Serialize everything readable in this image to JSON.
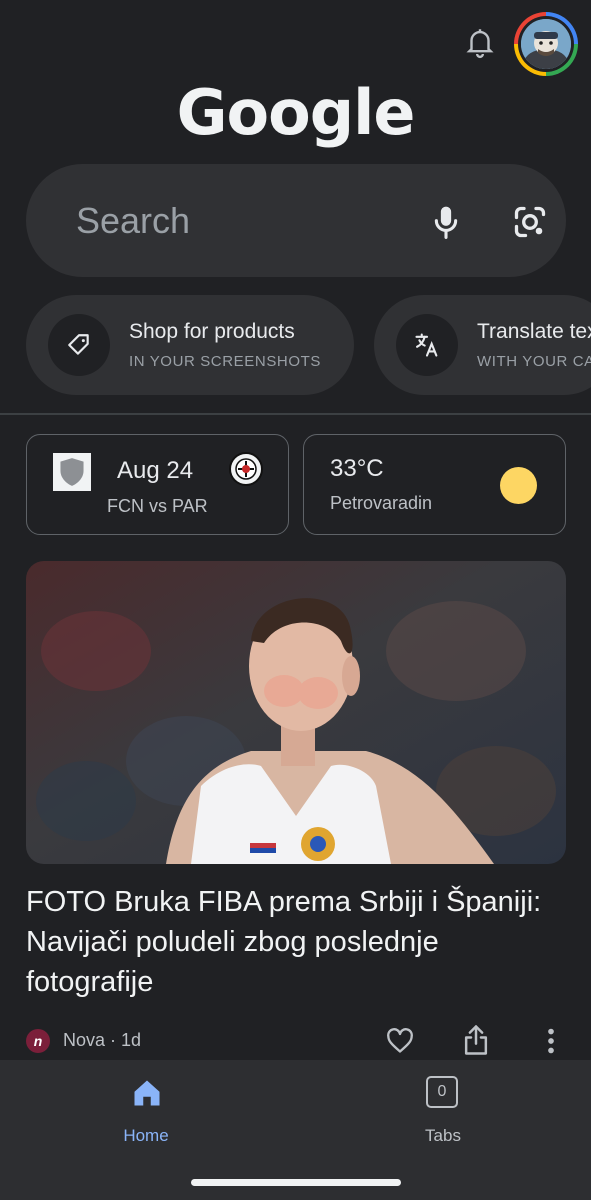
{
  "header": {
    "logo_text": "Google",
    "bell_icon": "bell-icon",
    "avatar_icon": "account-avatar"
  },
  "search": {
    "placeholder": "Search",
    "mic_icon": "mic-icon",
    "lens_icon": "google-lens-icon"
  },
  "actions": [
    {
      "title": "Shop for products",
      "subtitle": "IN YOUR SCREENSHOTS",
      "icon": "tag-icon"
    },
    {
      "title": "Translate text",
      "subtitle": "WITH YOUR CAMERA",
      "icon": "translate-icon"
    }
  ],
  "cards": {
    "sport": {
      "date": "Aug 24",
      "teams": "FCN vs PAR"
    },
    "weather": {
      "temperature": "33°C",
      "location": "Petrovaradin",
      "condition_icon": "sun-icon"
    }
  },
  "news": {
    "title": "FOTO Bruka FIBA prema Srbiji i Španiji: Navijači poludeli zbog poslednje fotografije",
    "source_logo_letter": "n",
    "source": "Nova · 1d"
  },
  "bottom_nav": {
    "home_label": "Home",
    "tabs_label": "Tabs",
    "tabs_count": "0"
  },
  "colors": {
    "background": "#202124",
    "surface": "#303134",
    "accent": "#8ab4f8",
    "sun": "#fdd663"
  }
}
